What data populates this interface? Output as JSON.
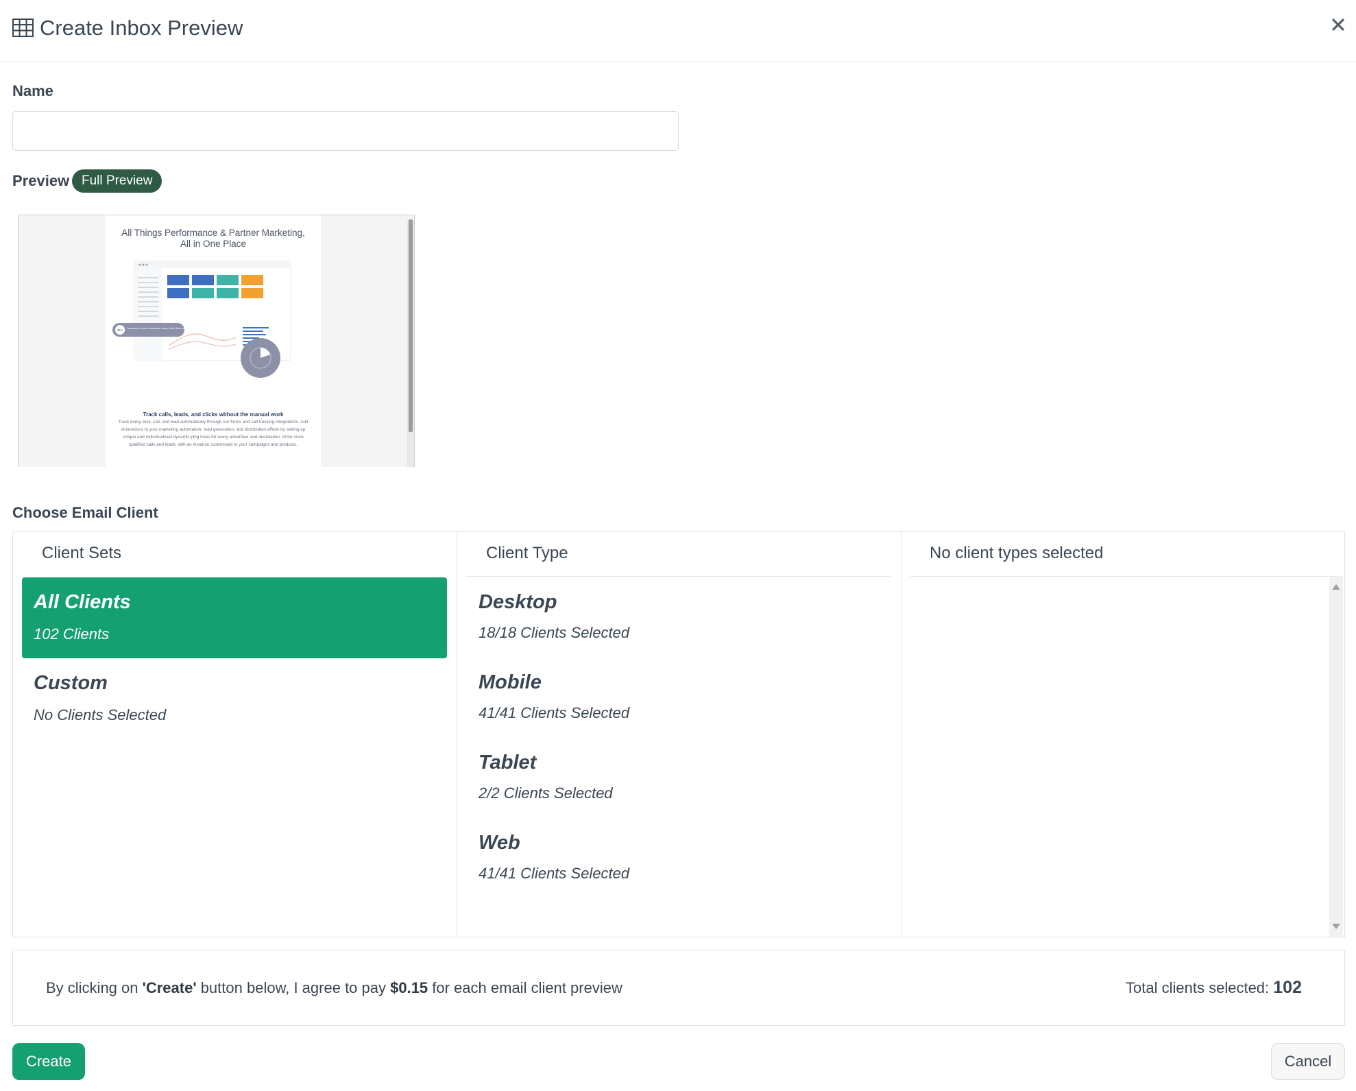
{
  "dialog": {
    "title": "Create Inbox Preview",
    "title_icon": "table-icon",
    "close_icon": "close-icon"
  },
  "form": {
    "name_label": "Name",
    "name_value": "",
    "name_placeholder": "",
    "preview_label": "Preview",
    "full_preview_label": "Full Preview"
  },
  "email_preview": {
    "headline_line1": "All Things Performance & Partner Marketing,",
    "headline_line2": "All in One Place",
    "badge_text": "35%",
    "badge_caption": "Increase in lead conversion rates in the first month",
    "subheading": "Track calls, leads, and clicks without the manual work",
    "body": "Track every click, call, and lead automatically through our forms and call tracking integrations. Add dimensions to your marketing automation, lead generation, and distribution efforts by setting up unique and individualised dynamic ping trees for every advertiser and destination. Drive more qualified calls and leads, with an instance customised to your campaigns and products.",
    "tile_colors": [
      "#3f6fc0",
      "#3f6fc0",
      "#3fb3a8",
      "#f0a12f",
      "#3f6fc0",
      "#3fb3a8",
      "#3fb3a8",
      "#f0a12f"
    ]
  },
  "client_chooser": {
    "label": "Choose Email Client",
    "sets_header": "Client Sets",
    "sets": [
      {
        "title": "All Clients",
        "subtitle": "102 Clients",
        "active": true
      },
      {
        "title": "Custom",
        "subtitle": "No Clients Selected",
        "active": false
      }
    ],
    "types_header": "Client Type",
    "types": [
      {
        "title": "Desktop",
        "subtitle": "18/18 Clients Selected"
      },
      {
        "title": "Mobile",
        "subtitle": "41/41 Clients Selected"
      },
      {
        "title": "Tablet",
        "subtitle": "2/2 Clients Selected"
      },
      {
        "title": "Web",
        "subtitle": "41/41 Clients Selected"
      }
    ],
    "third_header": "No client types selected"
  },
  "agreement": {
    "prefix": "By clicking on ",
    "create_word": "'Create'",
    "middle": " button below, I agree to pay ",
    "price": "$0.15",
    "suffix": " for each email client preview",
    "total_label": "Total clients selected: ",
    "total_value": "102"
  },
  "actions": {
    "create_label": "Create",
    "cancel_label": "Cancel"
  },
  "colors": {
    "accent": "#14a071",
    "badge_dark": "#2f5b45",
    "text": "#3a4652"
  }
}
